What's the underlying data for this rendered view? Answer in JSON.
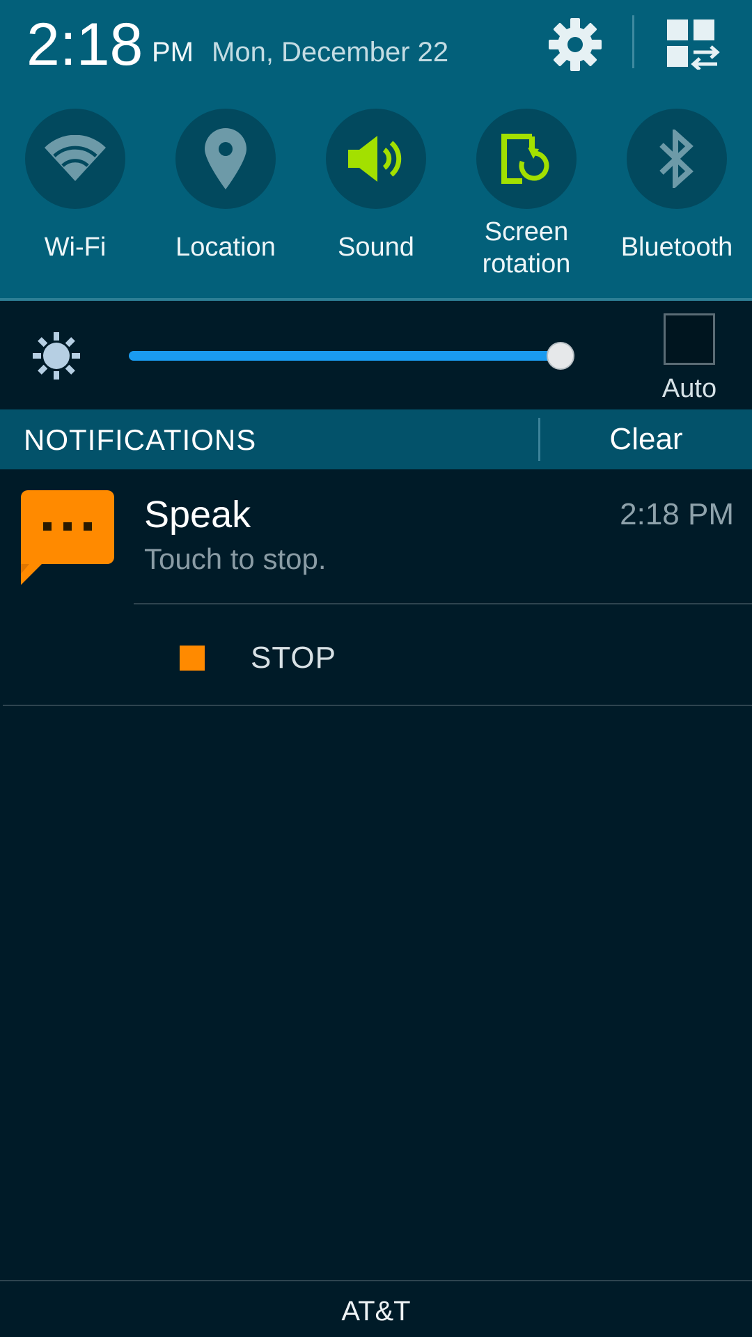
{
  "header": {
    "time": "2:18",
    "ampm": "PM",
    "date": "Mon, December 22",
    "settings_icon": "gear-icon",
    "edit_icon": "grid-swap-icon"
  },
  "quick_toggles": [
    {
      "label": "Wi-Fi",
      "icon": "wifi-icon",
      "active": false
    },
    {
      "label": "Location",
      "icon": "location-pin-icon",
      "active": false
    },
    {
      "label": "Sound",
      "icon": "speaker-icon",
      "active": true
    },
    {
      "label": "Screen rotation",
      "icon": "screen-rotation-icon",
      "active": true
    },
    {
      "label": "Bluetooth",
      "icon": "bluetooth-icon",
      "active": false
    }
  ],
  "brightness": {
    "icon": "sun-icon",
    "level": 0.975,
    "auto_label": "Auto",
    "auto_checked": false
  },
  "notifications_header": {
    "title": "NOTIFICATIONS",
    "clear_label": "Clear"
  },
  "notification": {
    "app_icon": "speech-bubble-icon",
    "title": "Speak",
    "time": "2:18 PM",
    "text": "Touch to stop.",
    "action_label": "STOP",
    "action_icon": "stop-square-icon"
  },
  "carrier": "AT&T",
  "colors": {
    "panel": "#03607a",
    "background": "#001b28",
    "active_toggle": "#a3e000",
    "inactive_icon": "#6d9aa8",
    "slider": "#1a9bf0",
    "accent_orange": "#ff8a00"
  }
}
